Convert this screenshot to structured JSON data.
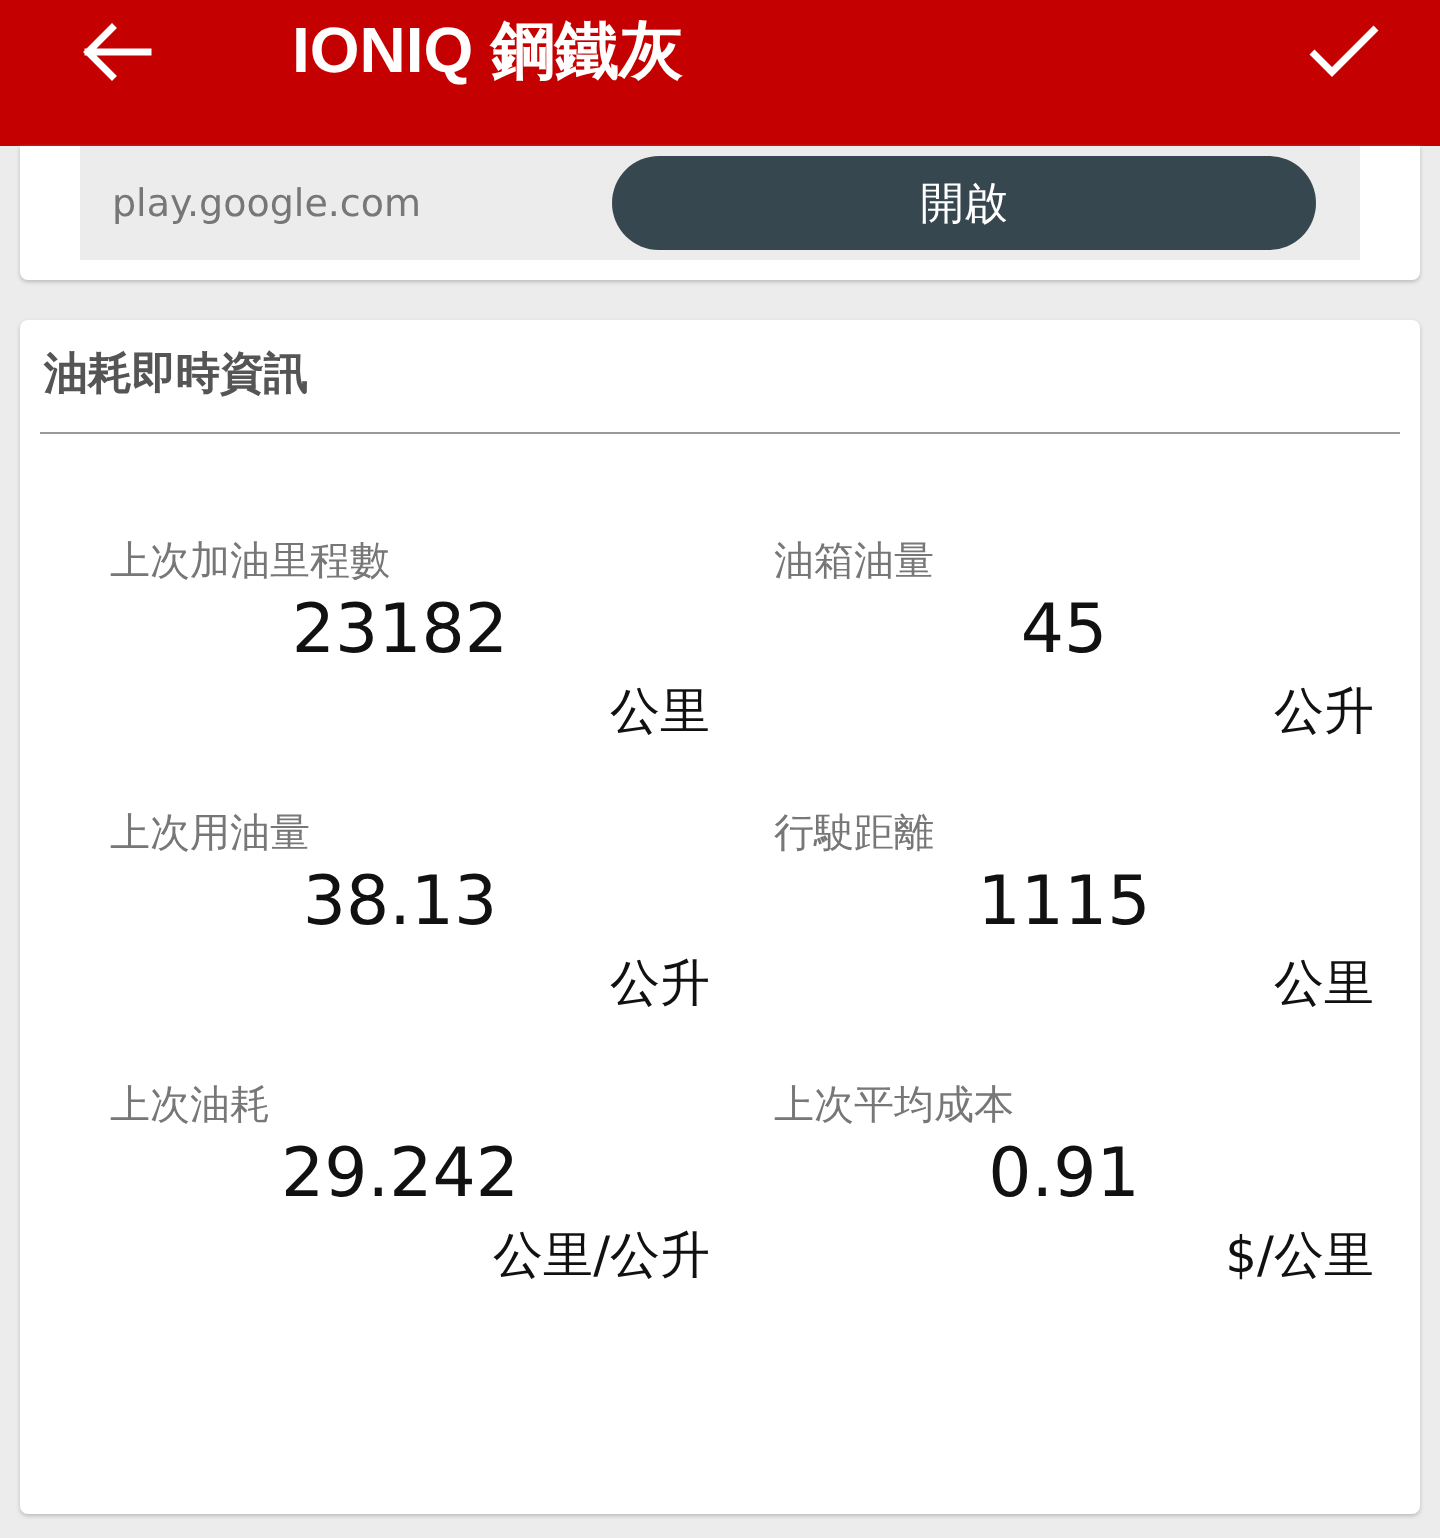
{
  "app_bar": {
    "title": "IONIQ 鋼鐵灰"
  },
  "banner": {
    "source": "play.google.com",
    "button": "開啟"
  },
  "card": {
    "title": "油耗即時資訊",
    "stats": [
      {
        "label": "上次加油里程數",
        "value": "23182",
        "unit": "公里"
      },
      {
        "label": "油箱油量",
        "value": "45",
        "unit": "公升"
      },
      {
        "label": "上次用油量",
        "value": "38.13",
        "unit": "公升"
      },
      {
        "label": "行駛距離",
        "value": "1115",
        "unit": "公里"
      },
      {
        "label": "上次油耗",
        "value": "29.242",
        "unit": "公里/公升"
      },
      {
        "label": "上次平均成本",
        "value": "0.91",
        "unit": "$/公里"
      }
    ]
  }
}
